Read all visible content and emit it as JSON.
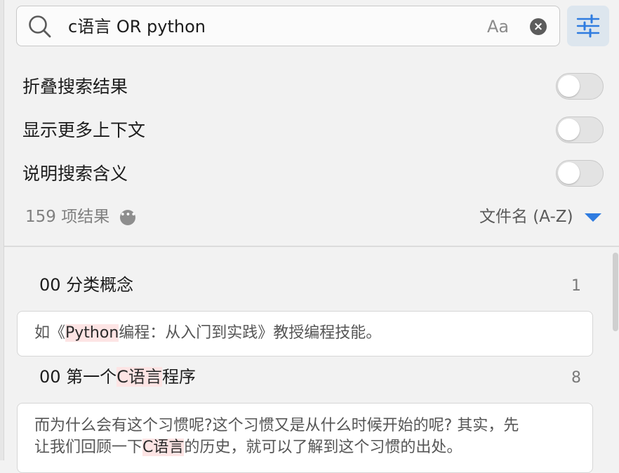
{
  "search": {
    "query": "c语言 OR python",
    "case_label": "Aa",
    "clear_label": "×"
  },
  "options": [
    {
      "label": "折叠搜索结果",
      "on": false
    },
    {
      "label": "显示更多上下文",
      "on": false
    },
    {
      "label": "说明搜索含义",
      "on": false
    }
  ],
  "results": {
    "count_label": "159 项结果",
    "more_label": "•••",
    "sort_label": "文件名 (A-Z)"
  },
  "groups": [
    {
      "title_before": "00 分类概念",
      "title_hl": "",
      "title_after": "",
      "count": "1",
      "snippet": {
        "line1_before": "如《",
        "line1_hl": "Python",
        "line1_after": "编程：从入门到实践》教授编程技能。"
      }
    },
    {
      "title_before": "00 第一个",
      "title_hl": "C语言",
      "title_after": "程序",
      "count": "8",
      "snippet": {
        "line1": "而为什么会有这个习惯呢?这个习惯又是从什么时候开始的呢? 其实，先",
        "line2_before": "让我们回顾一下",
        "line2_hl": "C语言",
        "line2_after": "的历史，就可以了解到这个习惯的出处。"
      }
    }
  ],
  "colors": {
    "accent": "#2f7ce0",
    "highlight": "#fde4e4",
    "filter_button_bg": "#dde6ee"
  }
}
